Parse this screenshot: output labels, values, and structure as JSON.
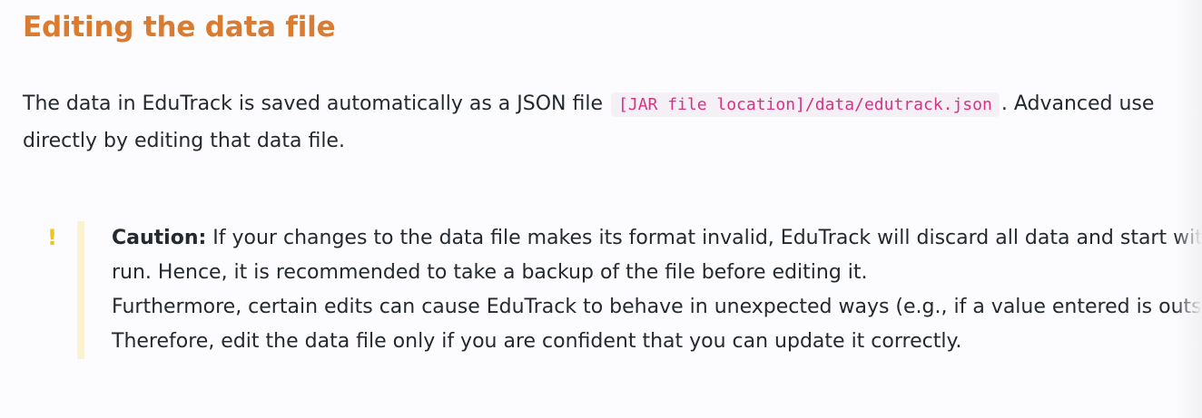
{
  "heading": "Editing the data file",
  "paragraph": {
    "text_before_code": "The data in EduTrack is saved automatically as a JSON file ",
    "code": "[JAR file location]/data/edutrack.json",
    "text_after_code": ". Advanced use",
    "line2": "directly by editing that data file."
  },
  "callout": {
    "icon": "exclamation-icon",
    "icon_glyph": "!",
    "accent_color": "#f0c419",
    "label": "Caution:",
    "line1_rest": " If your changes to the data file makes its format invalid, EduTrack will discard all data and start wit",
    "line2": "run. Hence, it is recommended to take a backup of the file before editing it.",
    "line3": "Furthermore, certain edits can cause EduTrack to behave in unexpected ways (e.g., if a value entered is outsi",
    "line4": "Therefore, edit the data file only if you are confident that you can update it correctly."
  },
  "colors": {
    "heading": "#d97b30",
    "code_text": "#d63384",
    "code_bg": "#f4f0f6",
    "callout_bar": "#fbf2cf"
  }
}
